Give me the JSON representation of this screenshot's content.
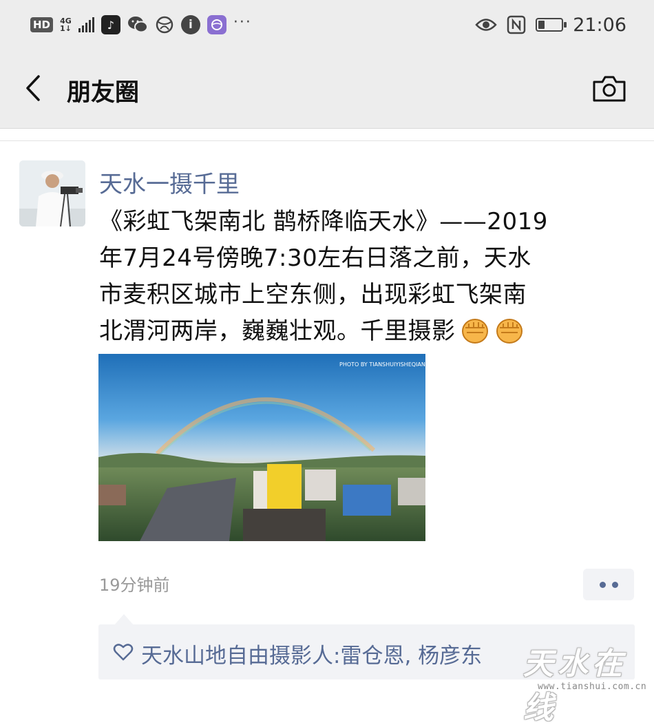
{
  "status_bar": {
    "left_badge": "HD",
    "network_top": "4G",
    "network_bottom": "1↓",
    "more": "···",
    "time": "21:06",
    "battery_level_fraction": 0.3,
    "icons_left": [
      "hd-icon",
      "signal-icon",
      "tiktok-icon",
      "wechat-icon",
      "browser-icon",
      "info-icon",
      "app-icon"
    ],
    "icons_right": [
      "eye-icon",
      "nfc-icon",
      "battery-icon"
    ]
  },
  "nav": {
    "title": "朋友圈",
    "back_icon": "chevron-left-icon",
    "camera_icon": "camera-icon"
  },
  "post": {
    "author": "天水一摄千里",
    "text_lines": [
      "《彩虹飞架南北  鹊桥降临天水》——2019",
      "年7月24号傍晚7:30左右日落之前，天水",
      "市麦积区城市上空东侧，出现彩虹飞架南",
      "北渭河两岸，巍巍壮观。千里摄影"
    ],
    "emoji": [
      "fist-emoji",
      "fist-emoji"
    ],
    "photo_watermark": "PHOTO BY TIANSHUIYISHEQIANLI",
    "timestamp": "19分钟前",
    "likes": "天水山地自由摄影人:雷仓恩, 杨彦东"
  },
  "watermark": {
    "logo": "天水在线",
    "url": "www.tianshui.com.cn"
  },
  "colors": {
    "bar_bg": "#ededed",
    "link": "#576b95",
    "likes_bg": "#f2f3f6"
  }
}
